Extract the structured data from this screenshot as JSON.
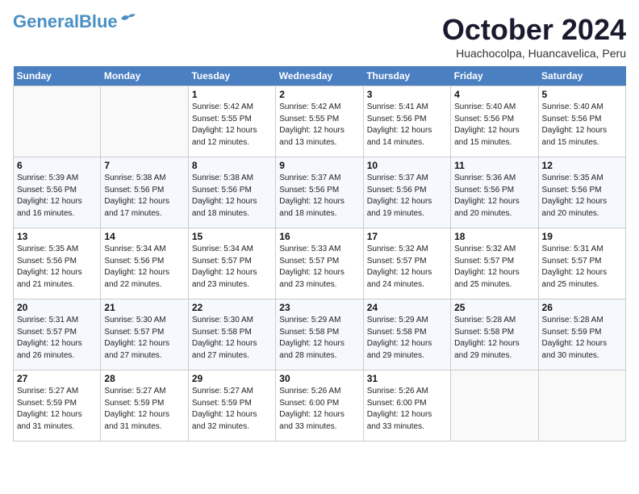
{
  "header": {
    "logo_line1": "General",
    "logo_line2": "Blue",
    "month": "October 2024",
    "location": "Huachocolpa, Huancavelica, Peru"
  },
  "weekdays": [
    "Sunday",
    "Monday",
    "Tuesday",
    "Wednesday",
    "Thursday",
    "Friday",
    "Saturday"
  ],
  "weeks": [
    [
      {
        "day": "",
        "sunrise": "",
        "sunset": "",
        "daylight": ""
      },
      {
        "day": "",
        "sunrise": "",
        "sunset": "",
        "daylight": ""
      },
      {
        "day": "1",
        "sunrise": "Sunrise: 5:42 AM",
        "sunset": "Sunset: 5:55 PM",
        "daylight": "Daylight: 12 hours and 12 minutes."
      },
      {
        "day": "2",
        "sunrise": "Sunrise: 5:42 AM",
        "sunset": "Sunset: 5:55 PM",
        "daylight": "Daylight: 12 hours and 13 minutes."
      },
      {
        "day": "3",
        "sunrise": "Sunrise: 5:41 AM",
        "sunset": "Sunset: 5:56 PM",
        "daylight": "Daylight: 12 hours and 14 minutes."
      },
      {
        "day": "4",
        "sunrise": "Sunrise: 5:40 AM",
        "sunset": "Sunset: 5:56 PM",
        "daylight": "Daylight: 12 hours and 15 minutes."
      },
      {
        "day": "5",
        "sunrise": "Sunrise: 5:40 AM",
        "sunset": "Sunset: 5:56 PM",
        "daylight": "Daylight: 12 hours and 15 minutes."
      }
    ],
    [
      {
        "day": "6",
        "sunrise": "Sunrise: 5:39 AM",
        "sunset": "Sunset: 5:56 PM",
        "daylight": "Daylight: 12 hours and 16 minutes."
      },
      {
        "day": "7",
        "sunrise": "Sunrise: 5:38 AM",
        "sunset": "Sunset: 5:56 PM",
        "daylight": "Daylight: 12 hours and 17 minutes."
      },
      {
        "day": "8",
        "sunrise": "Sunrise: 5:38 AM",
        "sunset": "Sunset: 5:56 PM",
        "daylight": "Daylight: 12 hours and 18 minutes."
      },
      {
        "day": "9",
        "sunrise": "Sunrise: 5:37 AM",
        "sunset": "Sunset: 5:56 PM",
        "daylight": "Daylight: 12 hours and 18 minutes."
      },
      {
        "day": "10",
        "sunrise": "Sunrise: 5:37 AM",
        "sunset": "Sunset: 5:56 PM",
        "daylight": "Daylight: 12 hours and 19 minutes."
      },
      {
        "day": "11",
        "sunrise": "Sunrise: 5:36 AM",
        "sunset": "Sunset: 5:56 PM",
        "daylight": "Daylight: 12 hours and 20 minutes."
      },
      {
        "day": "12",
        "sunrise": "Sunrise: 5:35 AM",
        "sunset": "Sunset: 5:56 PM",
        "daylight": "Daylight: 12 hours and 20 minutes."
      }
    ],
    [
      {
        "day": "13",
        "sunrise": "Sunrise: 5:35 AM",
        "sunset": "Sunset: 5:56 PM",
        "daylight": "Daylight: 12 hours and 21 minutes."
      },
      {
        "day": "14",
        "sunrise": "Sunrise: 5:34 AM",
        "sunset": "Sunset: 5:56 PM",
        "daylight": "Daylight: 12 hours and 22 minutes."
      },
      {
        "day": "15",
        "sunrise": "Sunrise: 5:34 AM",
        "sunset": "Sunset: 5:57 PM",
        "daylight": "Daylight: 12 hours and 23 minutes."
      },
      {
        "day": "16",
        "sunrise": "Sunrise: 5:33 AM",
        "sunset": "Sunset: 5:57 PM",
        "daylight": "Daylight: 12 hours and 23 minutes."
      },
      {
        "day": "17",
        "sunrise": "Sunrise: 5:32 AM",
        "sunset": "Sunset: 5:57 PM",
        "daylight": "Daylight: 12 hours and 24 minutes."
      },
      {
        "day": "18",
        "sunrise": "Sunrise: 5:32 AM",
        "sunset": "Sunset: 5:57 PM",
        "daylight": "Daylight: 12 hours and 25 minutes."
      },
      {
        "day": "19",
        "sunrise": "Sunrise: 5:31 AM",
        "sunset": "Sunset: 5:57 PM",
        "daylight": "Daylight: 12 hours and 25 minutes."
      }
    ],
    [
      {
        "day": "20",
        "sunrise": "Sunrise: 5:31 AM",
        "sunset": "Sunset: 5:57 PM",
        "daylight": "Daylight: 12 hours and 26 minutes."
      },
      {
        "day": "21",
        "sunrise": "Sunrise: 5:30 AM",
        "sunset": "Sunset: 5:57 PM",
        "daylight": "Daylight: 12 hours and 27 minutes."
      },
      {
        "day": "22",
        "sunrise": "Sunrise: 5:30 AM",
        "sunset": "Sunset: 5:58 PM",
        "daylight": "Daylight: 12 hours and 27 minutes."
      },
      {
        "day": "23",
        "sunrise": "Sunrise: 5:29 AM",
        "sunset": "Sunset: 5:58 PM",
        "daylight": "Daylight: 12 hours and 28 minutes."
      },
      {
        "day": "24",
        "sunrise": "Sunrise: 5:29 AM",
        "sunset": "Sunset: 5:58 PM",
        "daylight": "Daylight: 12 hours and 29 minutes."
      },
      {
        "day": "25",
        "sunrise": "Sunrise: 5:28 AM",
        "sunset": "Sunset: 5:58 PM",
        "daylight": "Daylight: 12 hours and 29 minutes."
      },
      {
        "day": "26",
        "sunrise": "Sunrise: 5:28 AM",
        "sunset": "Sunset: 5:59 PM",
        "daylight": "Daylight: 12 hours and 30 minutes."
      }
    ],
    [
      {
        "day": "27",
        "sunrise": "Sunrise: 5:27 AM",
        "sunset": "Sunset: 5:59 PM",
        "daylight": "Daylight: 12 hours and 31 minutes."
      },
      {
        "day": "28",
        "sunrise": "Sunrise: 5:27 AM",
        "sunset": "Sunset: 5:59 PM",
        "daylight": "Daylight: 12 hours and 31 minutes."
      },
      {
        "day": "29",
        "sunrise": "Sunrise: 5:27 AM",
        "sunset": "Sunset: 5:59 PM",
        "daylight": "Daylight: 12 hours and 32 minutes."
      },
      {
        "day": "30",
        "sunrise": "Sunrise: 5:26 AM",
        "sunset": "Sunset: 6:00 PM",
        "daylight": "Daylight: 12 hours and 33 minutes."
      },
      {
        "day": "31",
        "sunrise": "Sunrise: 5:26 AM",
        "sunset": "Sunset: 6:00 PM",
        "daylight": "Daylight: 12 hours and 33 minutes."
      },
      {
        "day": "",
        "sunrise": "",
        "sunset": "",
        "daylight": ""
      },
      {
        "day": "",
        "sunrise": "",
        "sunset": "",
        "daylight": ""
      }
    ]
  ]
}
